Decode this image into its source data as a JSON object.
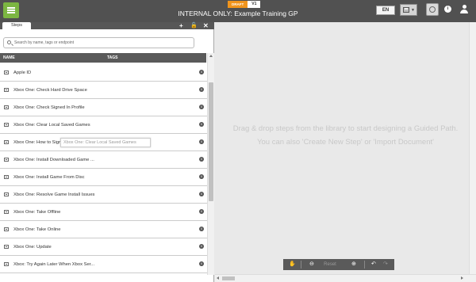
{
  "header": {
    "draft_badge": "DRAFT",
    "version_badge": "V1",
    "title": "INTERNAL ONLY: Example Training GP",
    "language": "EN"
  },
  "library": {
    "tab_label": "Steps",
    "search_placeholder": "Search by name, tags or endpoint",
    "columns": {
      "name": "NAME",
      "tags": "TAGS"
    },
    "items": [
      {
        "label": "Apple ID"
      },
      {
        "label": "Xbox One: Check Hard Drive Space"
      },
      {
        "label": "Xbox One: Check Signed In Profile"
      },
      {
        "label": "Xbox One: Clear Local Saved Games"
      },
      {
        "label": "Xbox One: How to Sign in/Out"
      },
      {
        "label": "Xbox One: Install Downloaded Game ..."
      },
      {
        "label": "Xbox One: Install Game From Disc"
      },
      {
        "label": "Xbox One: Resolve Game Install Issues"
      },
      {
        "label": "Xbox One: Take Offline"
      },
      {
        "label": "Xbox One: Take Online"
      },
      {
        "label": "Xbox One: Update"
      },
      {
        "label": "Xbox: Try Again Later When Xbox Ser..."
      }
    ],
    "tooltip": "Xbox One: Clear Local Saved Games"
  },
  "canvas": {
    "empty_line1": "Drag & drop steps from the library to start designing a Guided Path.",
    "empty_line2": "You can also 'Create New Step' or 'Import Document'",
    "zoom_reset": "Reset"
  }
}
